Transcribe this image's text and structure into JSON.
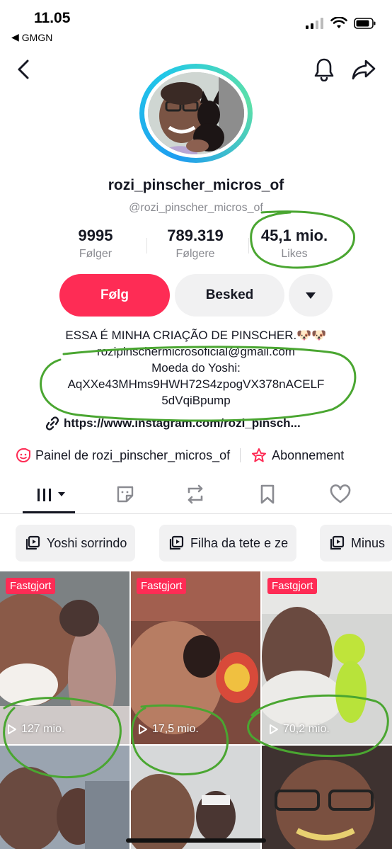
{
  "status_bar": {
    "time": "11.05",
    "back_app": "GMGN"
  },
  "profile": {
    "username": "rozi_pinscher_micros_of",
    "handle": "@rozi_pinscher_micros_of"
  },
  "stats": [
    {
      "value": "9995",
      "label": "Følger"
    },
    {
      "value": "789.319",
      "label": "Følgere"
    },
    {
      "value": "45,1 mio.",
      "label": "Likes"
    }
  ],
  "actions": {
    "follow": "Følg",
    "message": "Besked"
  },
  "bio": {
    "line1": "ESSA É MINHA CRIAÇÃO DE PINSCHER.🐶🐶",
    "line2": "rozipinschermicrosoficial@gmail.com",
    "line3": "Moeda do Yoshi:",
    "line4": "AqXXe43MHms9HWH72S4zpogVX378nACELF",
    "line5": "5dVqiBpump"
  },
  "link": "https://www.instagram.com/rozi_pinsch...",
  "panel_row": {
    "panel": "Painel de rozi_pinscher_micros_of",
    "subscription": "Abonnement"
  },
  "tabs": [
    "videos-grid",
    "favorites",
    "reposts",
    "saved",
    "liked"
  ],
  "playlists": [
    "Yoshi sorrindo",
    "Filha da tete e ze",
    "Minus"
  ],
  "videos": [
    {
      "pinned": "Fastgjort",
      "views": "127 mio."
    },
    {
      "pinned": "Fastgjort",
      "views": "17,5 mio."
    },
    {
      "pinned": "Fastgjort",
      "views": "70,2 mio."
    },
    {
      "pinned": "",
      "views": ""
    },
    {
      "pinned": "",
      "views": ""
    },
    {
      "pinned": "",
      "views": ""
    }
  ],
  "colors": {
    "accent": "#fe2c55",
    "annotation": "#4aa631",
    "text": "#161823",
    "muted": "#8a8b91"
  }
}
